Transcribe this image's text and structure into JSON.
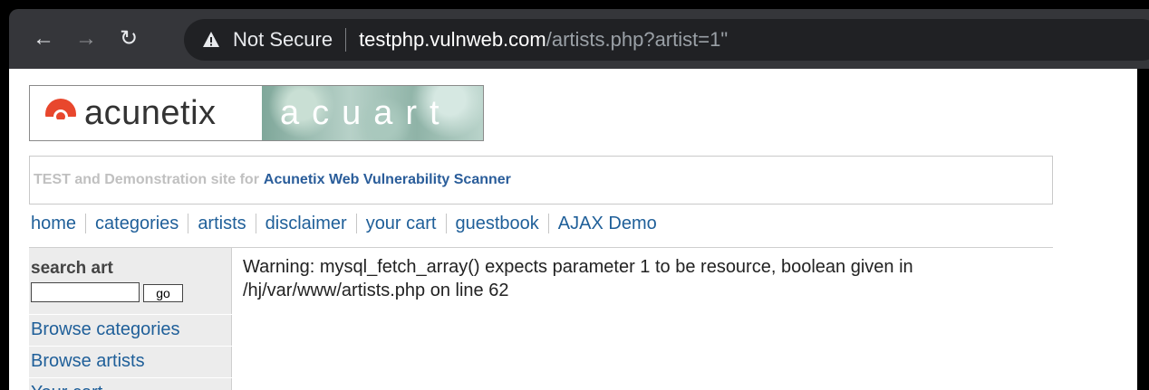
{
  "browser": {
    "security_label": "Not Secure",
    "url_host": "testphp.vulnweb.com",
    "url_path": "/artists.php?artist=1\""
  },
  "logo": {
    "left_word": "acunetix",
    "right_word": "acuart"
  },
  "tagline": {
    "prefix": "TEST and Demonstration site for",
    "brand": "Acunetix Web Vulnerability Scanner"
  },
  "menu": {
    "items": [
      "home",
      "categories",
      "artists",
      "disclaimer",
      "your cart",
      "guestbook",
      "AJAX Demo"
    ]
  },
  "sidebar": {
    "search_title": "search art",
    "search_value": "",
    "go_label": "go",
    "links": [
      "Browse categories",
      "Browse artists",
      "Your cart"
    ]
  },
  "content": {
    "warning": "Warning: mysql_fetch_array() expects parameter 1 to be resource, boolean given in /hj/var/www/artists.php on line 62"
  },
  "colors": {
    "link": "#1f5f99",
    "chrome": "#35363a",
    "omnibox": "#202124"
  }
}
